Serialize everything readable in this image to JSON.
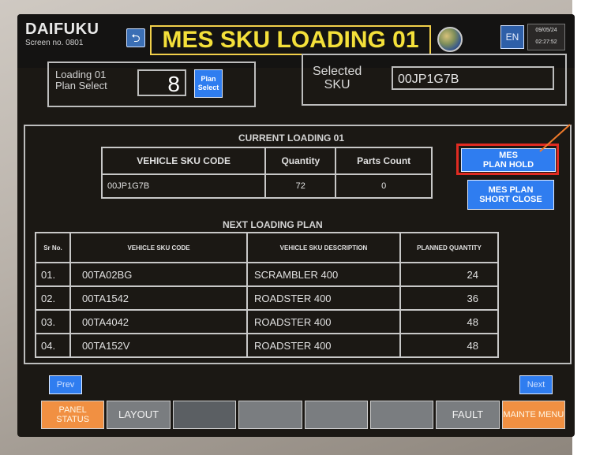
{
  "header": {
    "logo": "DAIFUKU",
    "screen_no_label": "Screen no.",
    "screen_no": "0801",
    "title": "MES SKU LOADING 01",
    "lang": "EN",
    "date": "09/05/24",
    "time": "02:27:52",
    "back_icon": "return-icon",
    "globe_icon": "globe-icon"
  },
  "plan": {
    "label_line1": "Loading 01",
    "label_line2": "Plan Select",
    "value": "8",
    "select_line1": "Plan",
    "select_line2": "Select"
  },
  "sku": {
    "label_line1": "Selected",
    "label_line2": "SKU",
    "value": "00JP1G7B"
  },
  "current": {
    "title": "CURRENT LOADING 01",
    "headers": [
      "VEHICLE SKU CODE",
      "Quantity",
      "Parts Count"
    ],
    "row": [
      "00JP1G7B",
      "72",
      "0"
    ]
  },
  "buttons": {
    "mes_hold_line1": "MES",
    "mes_hold_line2": "PLAN HOLD",
    "mes_short_line1": "MES PLAN",
    "mes_short_line2": "SHORT CLOSE",
    "prev": "Prev",
    "next": "Next"
  },
  "next_plan": {
    "title": "NEXT LOADING PLAN",
    "headers": [
      "Sr No.",
      "VEHICLE SKU CODE",
      "VEHICLE SKU DESCRIPTION",
      "PLANNED QUANTITY"
    ],
    "rows": [
      [
        "01.",
        "00TA02BG",
        "SCRAMBLER 400",
        "24"
      ],
      [
        "02.",
        "00TA1542",
        "ROADSTER 400",
        "36"
      ],
      [
        "03.",
        "00TA4042",
        "ROADSTER 400",
        "48"
      ],
      [
        "04.",
        "00TA152V",
        "ROADSTER 400",
        "48"
      ]
    ]
  },
  "footer": {
    "panel_status": "PANEL STATUS",
    "layout": "LAYOUT",
    "fault": "FAULT",
    "mainte_menu": "MAINTE MENU"
  },
  "colors": {
    "title": "#f4e03a",
    "button_blue": "#2f7df0",
    "highlight": "#e02b22",
    "footer_orange": "#f19042",
    "pointer": "#f07a2a"
  }
}
